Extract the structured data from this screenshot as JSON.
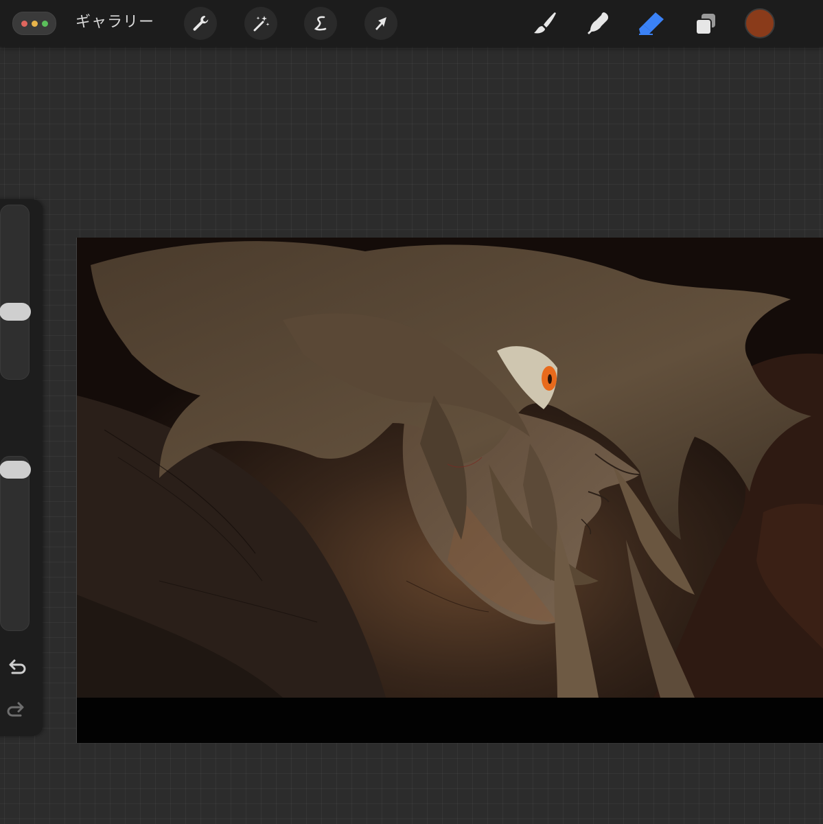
{
  "topbar": {
    "gallery_label": "ギャラリー",
    "menu_dot_colors": [
      "#e0665e",
      "#e8b44a",
      "#5bbf5b"
    ],
    "tools_left": [
      {
        "name": "wrench-icon",
        "label": "actions"
      },
      {
        "name": "magic-wand-icon",
        "label": "adjustments"
      },
      {
        "name": "selection-icon",
        "label": "selection"
      },
      {
        "name": "arrow-cursor-icon",
        "label": "transform"
      }
    ],
    "tools_right": [
      {
        "name": "brush-icon",
        "label": "paint"
      },
      {
        "name": "smudge-icon",
        "label": "smudge"
      },
      {
        "name": "eraser-icon",
        "label": "erase",
        "active": true
      },
      {
        "name": "layers-icon",
        "label": "layers"
      }
    ],
    "current_color": "#8a3b1a",
    "active_tool_color": "#3b82f6"
  },
  "sidebar": {
    "brush_size_level": 0.62,
    "opacity_level": 0.05,
    "icons": [
      "modify-square-icon",
      "undo-icon",
      "redo-icon"
    ]
  },
  "canvas": {
    "subject": "artwork-brown-haired-figure-orange-eye",
    "palette": [
      "#1a0f0b",
      "#5a4735",
      "#7a6650",
      "#e86a1c",
      "#3a2418"
    ]
  }
}
